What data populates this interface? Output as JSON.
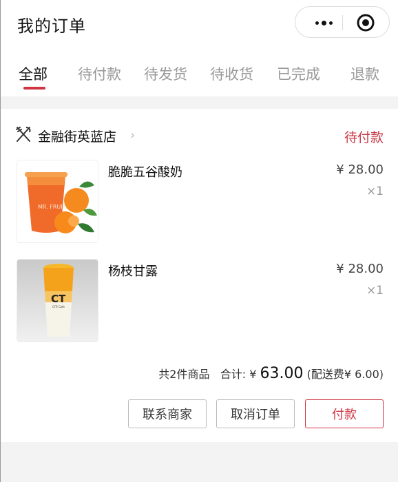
{
  "header": {
    "title": "我的订单",
    "tabs": [
      {
        "label": "全部",
        "active": true
      },
      {
        "label": "待付款"
      },
      {
        "label": "待发货"
      },
      {
        "label": "待收货"
      },
      {
        "label": "已完成"
      },
      {
        "label": "退款"
      }
    ]
  },
  "order": {
    "shop_name": "金融街英蓝店",
    "status": "待付款",
    "items": [
      {
        "name": "脆脆五谷酸奶",
        "price": "¥ 28.00",
        "qty": "×1",
        "image_label": "MR. FRUITS"
      },
      {
        "name": "杨枝甘露",
        "price": "¥ 28.00",
        "qty": "×1",
        "image_label": "CT",
        "image_sublabel": "CITI Cafe"
      }
    ],
    "summary": {
      "count": "共2件商品",
      "total_label": "合计:",
      "currency": "¥",
      "total": "63.00",
      "delivery": "(配送费¥ 6.00)"
    },
    "buttons": {
      "contact": "联系商家",
      "cancel": "取消订单",
      "pay": "付款"
    }
  },
  "colors": {
    "accent": "#d03342",
    "status": "#c83a48"
  }
}
